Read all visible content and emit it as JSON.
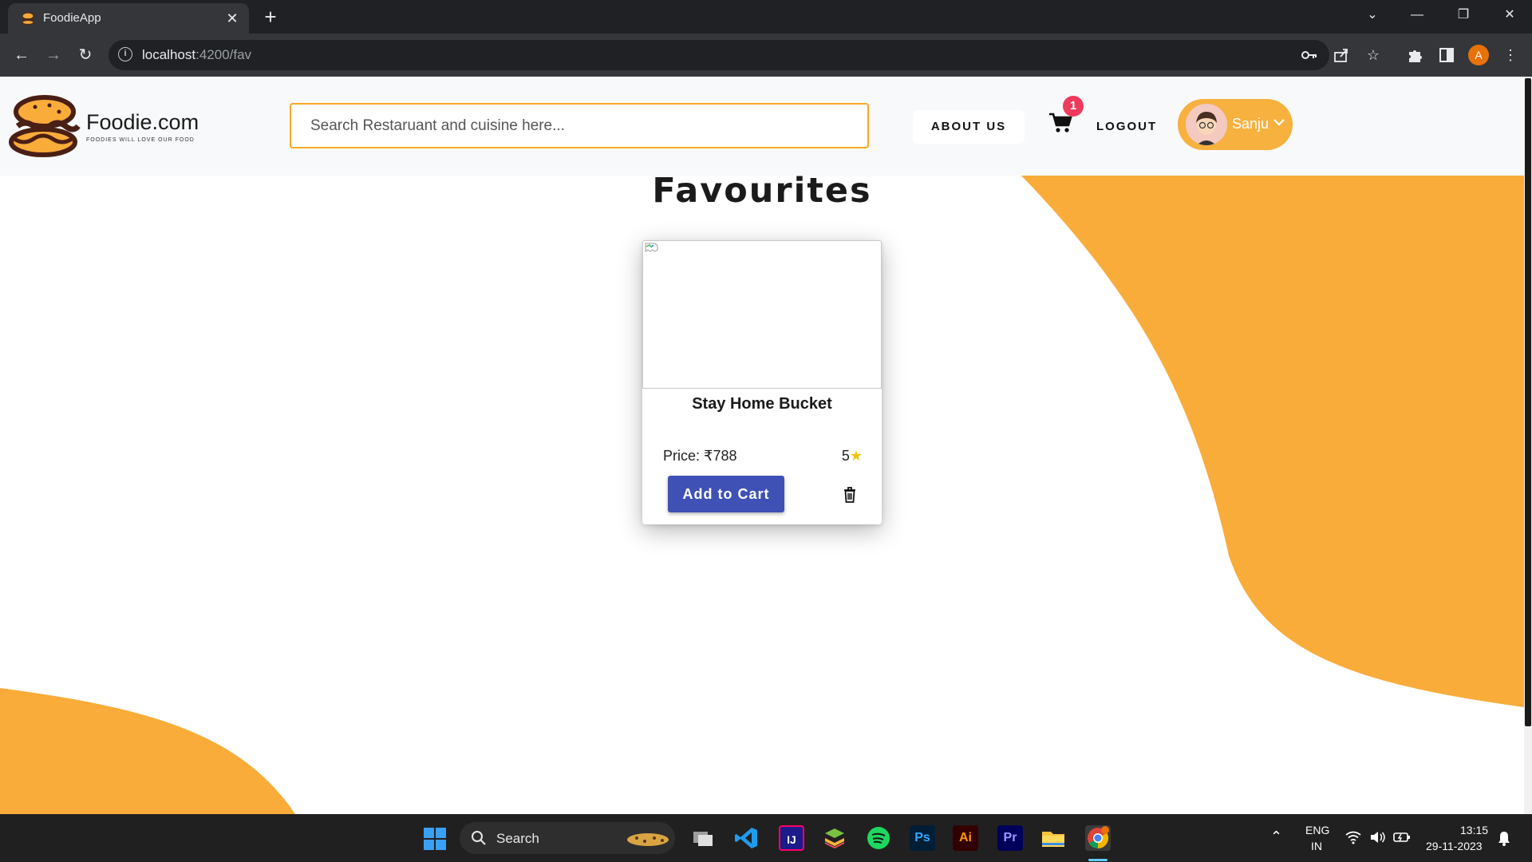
{
  "browser": {
    "tab_title": "FoodieApp",
    "tab_close": "✕",
    "new_tab": "+",
    "url_host": "localhost",
    "url_path": ":4200/fav",
    "profile_initial": "A"
  },
  "header": {
    "brand": "Foodie.com",
    "tagline": "FOODIES WILL LOVE OUR FOOD",
    "search_placeholder": "Search Restaruant and cuisine here...",
    "about_label": "ABOUT US",
    "cart_count": "1",
    "logout_label": "LOGOUT",
    "user_name": "Sanju"
  },
  "main": {
    "title": "Favourites",
    "cards": [
      {
        "name": "Stay Home Bucket",
        "price": "Price: ₹788",
        "rating": "5",
        "add_label": "Add to Cart"
      }
    ]
  },
  "taskbar": {
    "search_label": "Search",
    "apps": [
      "file-explorer-icon",
      "vscode-icon",
      "intellij-icon",
      "bluestacks-icon",
      "spotify-icon",
      "photoshop-icon",
      "illustrator-icon",
      "premiere-icon",
      "folder-icon",
      "chrome-icon"
    ],
    "ps_label": "Ps",
    "ai_label": "Ai",
    "pr_label": "Pr",
    "lang_top": "ENG",
    "lang_bottom": "IN",
    "time": "13:15",
    "date": "29-11-2023"
  },
  "colors": {
    "accent": "#f9a826",
    "button": "#3f51b5",
    "badge": "#ef3a5d",
    "blob": "#f9ac3a"
  }
}
